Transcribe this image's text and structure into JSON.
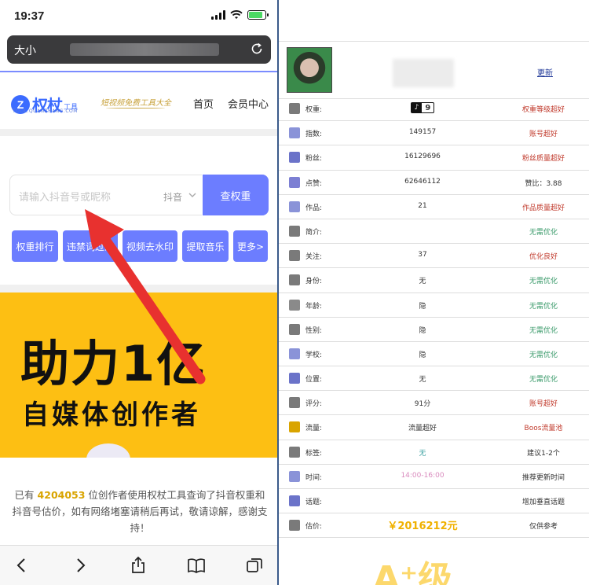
{
  "status": {
    "time": "19:37"
  },
  "browser": {
    "text_size": "大小"
  },
  "site": {
    "logo_char": "Z",
    "logo_name": "权杖",
    "logo_suffix": "工具",
    "logo_domain": "TOOL.QUANZHANG.COM",
    "slogan": "短视频免费工具大全",
    "nav": [
      "首页",
      "会员中心"
    ]
  },
  "search": {
    "placeholder": "请输入抖音号或昵称",
    "platform": "抖音",
    "button": "查权重"
  },
  "quick_buttons": [
    "权重排行",
    "违禁词过滤",
    "视频去水印",
    "提取音乐",
    "更多>"
  ],
  "banner": {
    "line1": "助力1亿",
    "line2": "自媒体创作者"
  },
  "info": {
    "prefix": "已有",
    "count": "4204053",
    "suffix": "位创作者使用权杖工具查询了抖音权重和抖音号估价，如有网络堵塞请稍后再试，敬请谅解，感谢支持！"
  },
  "result": {
    "update_link": "更新",
    "tiktok_label": "♪",
    "rows": [
      {
        "label": "权重:",
        "value": "9",
        "note": "权重等级超好",
        "note_color": "#c0392b",
        "icon_color": "#7a7a7a"
      },
      {
        "label": "指数:",
        "value": "149157",
        "note": "账号超好",
        "note_color": "#c0392b",
        "icon_color": "#8a93d8"
      },
      {
        "label": "粉丝:",
        "value": "16129696",
        "note": "粉丝质量超好",
        "note_color": "#c0392b",
        "icon_color": "#6b73c9"
      },
      {
        "label": "点赞:",
        "value": "62646112",
        "note": "赞比：3.88",
        "note_color": "#333333",
        "icon_color": "#7c7fd3"
      },
      {
        "label": "作品:",
        "value": "21",
        "note": "作品质量超好",
        "note_color": "#c0392b",
        "icon_color": "#8a93d8"
      },
      {
        "label": "简介:",
        "value": "",
        "note": "无需优化",
        "note_color": "#3a9a6a",
        "icon_color": "#7a7a7a"
      },
      {
        "label": "关注:",
        "value": "37",
        "note": "优化良好",
        "note_color": "#c0392b",
        "icon_color": "#7a7a7a"
      },
      {
        "label": "身份:",
        "value": "无",
        "note": "无需优化",
        "note_color": "#3a9a6a",
        "icon_color": "#7a7a7a"
      },
      {
        "label": "年龄:",
        "value": "隐",
        "note": "无需优化",
        "note_color": "#3a9a6a",
        "icon_color": "#8a8a8a"
      },
      {
        "label": "性别:",
        "value": "隐",
        "note": "无需优化",
        "note_color": "#3a9a6a",
        "icon_color": "#7a7a7a"
      },
      {
        "label": "学校:",
        "value": "隐",
        "note": "无需优化",
        "note_color": "#3a9a6a",
        "icon_color": "#8a93d8"
      },
      {
        "label": "位置:",
        "value": "无",
        "note": "无需优化",
        "note_color": "#3a9a6a",
        "icon_color": "#6b73c9"
      },
      {
        "label": "评分:",
        "value": "91分",
        "note": "账号超好",
        "note_color": "#c0392b",
        "icon_color": "#7a7a7a"
      },
      {
        "label": "流量:",
        "value": "流量超好",
        "note": "Boos流量池",
        "note_color": "#c0392b",
        "icon_color": "#d9a400"
      },
      {
        "label": "标签:",
        "value": "无",
        "note": "建议1-2个",
        "note_color": "#333333",
        "icon_color": "#7a7a7a",
        "value_color": "#3aa0a0"
      },
      {
        "label": "时间:",
        "value": "14:00-16:00",
        "note": "推荐更新时间",
        "note_color": "#333333",
        "icon_color": "#8a93d8",
        "value_color": "#d98abd"
      },
      {
        "label": "话题:",
        "value": "",
        "note": "增加垂直话题",
        "note_color": "#333333",
        "icon_color": "#6b73c9"
      },
      {
        "label": "估价:",
        "value": "￥2016212元",
        "note": "仅供参考",
        "note_color": "#333333",
        "icon_color": "#7a7a7a"
      }
    ]
  }
}
